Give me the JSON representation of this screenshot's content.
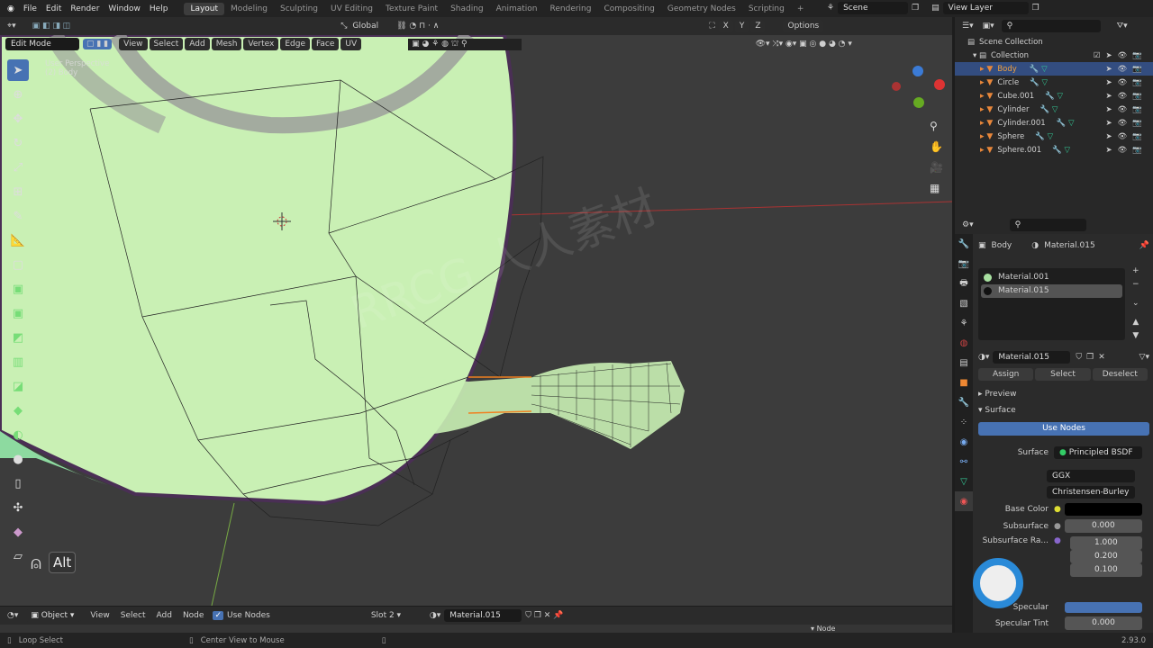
{
  "topbar": {
    "menu": [
      "File",
      "Edit",
      "Render",
      "Window",
      "Help"
    ],
    "workspaces": [
      "Layout",
      "Modeling",
      "Sculpting",
      "UV Editing",
      "Texture Paint",
      "Shading",
      "Animation",
      "Rendering",
      "Compositing",
      "Geometry Nodes",
      "Scripting"
    ],
    "active_workspace": "Layout",
    "add": "+",
    "scene": "Scene",
    "view_layer": "View Layer"
  },
  "tool_header": {
    "orientation": "Global",
    "axes": [
      "X",
      "Y",
      "Z"
    ],
    "options": "Options"
  },
  "viewport_header": {
    "mode": "Edit Mode",
    "menus": [
      "View",
      "Select",
      "Add",
      "Mesh",
      "Vertex",
      "Edge",
      "Face",
      "UV"
    ]
  },
  "viewport": {
    "perspective": "User Perspective",
    "object": "(2) Body",
    "key_hint": "Alt"
  },
  "outliner": {
    "scene_collection": "Scene Collection",
    "collection": "Collection",
    "objects": [
      {
        "name": "Body",
        "selected": true
      },
      {
        "name": "Circle"
      },
      {
        "name": "Cube.001"
      },
      {
        "name": "Cylinder"
      },
      {
        "name": "Cylinder.001"
      },
      {
        "name": "Sphere"
      },
      {
        "name": "Sphere.001"
      }
    ]
  },
  "properties": {
    "object": "Body",
    "material": "Material.015",
    "slots": [
      {
        "name": "Material.001",
        "color": "#a8e0a0"
      },
      {
        "name": "Material.015",
        "color": "#111111"
      }
    ],
    "assign": "Assign",
    "select": "Select",
    "deselect": "Deselect",
    "preview": "Preview",
    "surface_panel": "Surface",
    "use_nodes": "Use Nodes",
    "surface_label": "Surface",
    "surface_value": "Principled BSDF",
    "distribution": "GGX",
    "subsurface_method": "Christensen-Burley",
    "base_color_label": "Base Color",
    "base_color": "#000000",
    "subsurface_label": "Subsurface",
    "subsurface_value": "0.000",
    "subsurface_radius_label": "Subsurface Ra...",
    "subsurface_radius": [
      "1.000",
      "0.200",
      "0.100"
    ],
    "specular_label": "Specular",
    "specular_tint_label": "Specular Tint",
    "specular_tint": "0.000"
  },
  "node_header": {
    "mode": "Object",
    "menus": [
      "View",
      "Select",
      "Add",
      "Node"
    ],
    "use_nodes": "Use Nodes",
    "use_nodes_checked": true,
    "slot": "Slot 2",
    "material": "Material.015",
    "sidebar_panel": "Node"
  },
  "status": {
    "left": "Loop Select",
    "middle": "Center View to Mouse",
    "version": "2.93.0"
  },
  "watermark": "RRCG 人人素材",
  "colors": {
    "accent": "#4772b3",
    "mesh_green": "#c9f0b4",
    "selected_object": "#f0a040"
  }
}
